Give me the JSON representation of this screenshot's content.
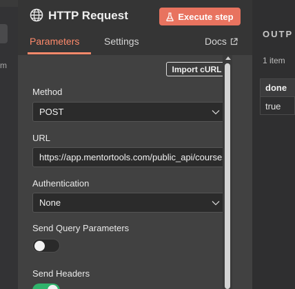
{
  "left": {
    "fragment": "m"
  },
  "node": {
    "title": "HTTP Request",
    "execute_label": "Execute step",
    "tabs": [
      {
        "label": "Parameters",
        "active": true
      },
      {
        "label": "Settings",
        "active": false
      }
    ],
    "docs_label": "Docs"
  },
  "params": {
    "import_label": "Import cURL",
    "method": {
      "label": "Method",
      "value": "POST"
    },
    "url": {
      "label": "URL",
      "value": "https://app.mentortools.com/public_api/courses"
    },
    "auth": {
      "label": "Authentication",
      "value": "None"
    },
    "send_query": {
      "label": "Send Query Parameters",
      "enabled": false
    },
    "send_headers": {
      "label": "Send Headers",
      "enabled": true
    }
  },
  "output": {
    "title": "OUTP",
    "count": "1 item",
    "table": {
      "header": "done",
      "value": "true"
    }
  },
  "colors": {
    "accent": "#ff8a6b",
    "execute_bg": "#e8735f",
    "toggle_on": "#2fb36b"
  }
}
